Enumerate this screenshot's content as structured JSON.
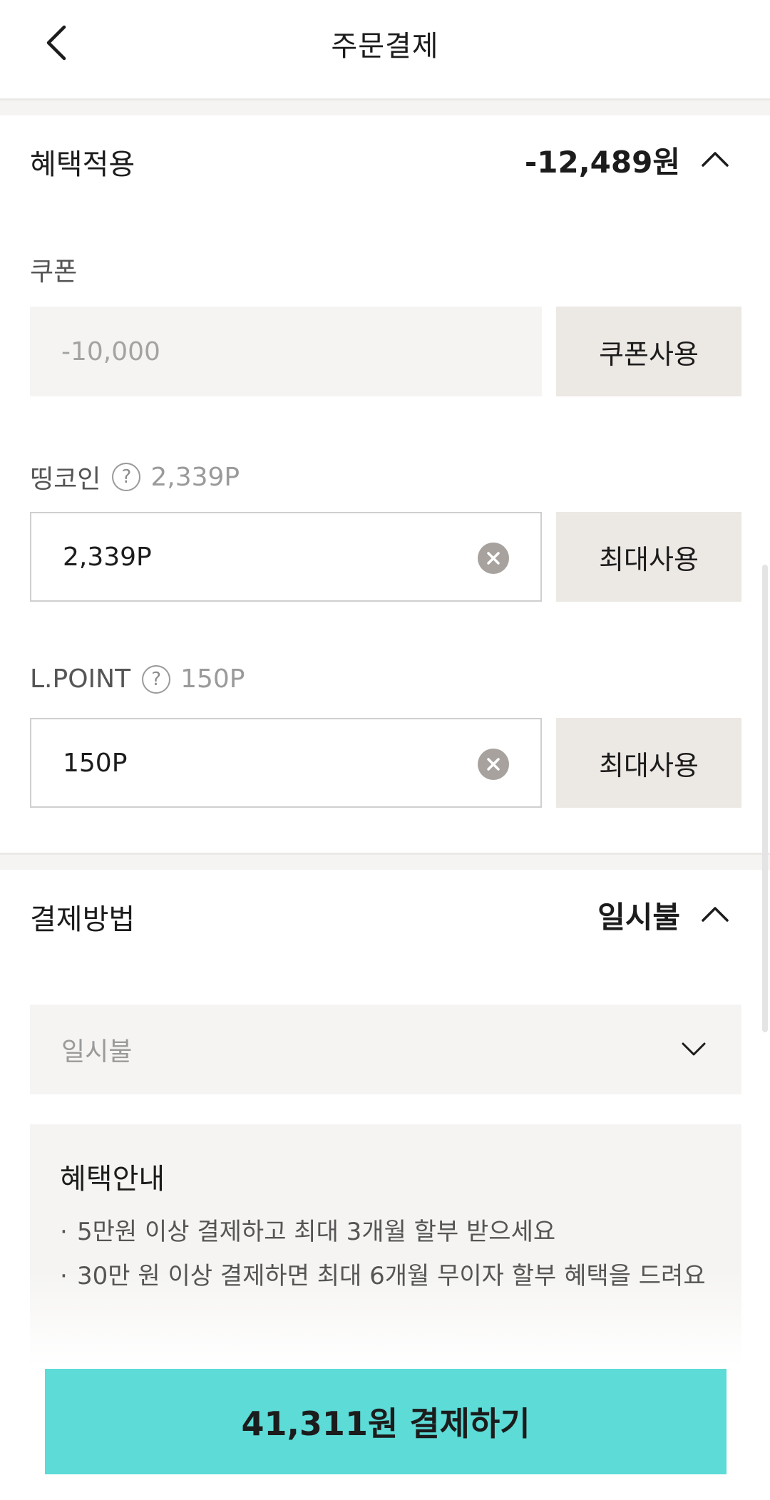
{
  "header": {
    "title": "주문결제",
    "back_icon": "chevron-left-icon"
  },
  "benefits": {
    "title": "혜택적용",
    "total": "-12,489원",
    "coupon": {
      "label": "쿠폰",
      "value": "-10,000",
      "button": "쿠폰사용"
    },
    "ding_coin": {
      "label": "띵코인",
      "help": "?",
      "balance": "2,339P",
      "value": "2,339P",
      "button": "최대사용"
    },
    "lpoint": {
      "label": "L.POINT",
      "help": "?",
      "balance": "150P",
      "value": "150P",
      "button": "최대사용"
    }
  },
  "payment": {
    "title": "결제방법",
    "summary": "일시불",
    "select_value": "일시불",
    "notice": {
      "title": "혜택안내",
      "items": [
        "5만원 이상 결제하고 최대 3개월 할부 받으세요",
        "30만 원 이상 결제하면 최대 6개월 무이자 할부 혜택을 드려요"
      ]
    }
  },
  "pay_button": {
    "label": "41,311원 결제하기",
    "color": "#5cdbd7"
  }
}
